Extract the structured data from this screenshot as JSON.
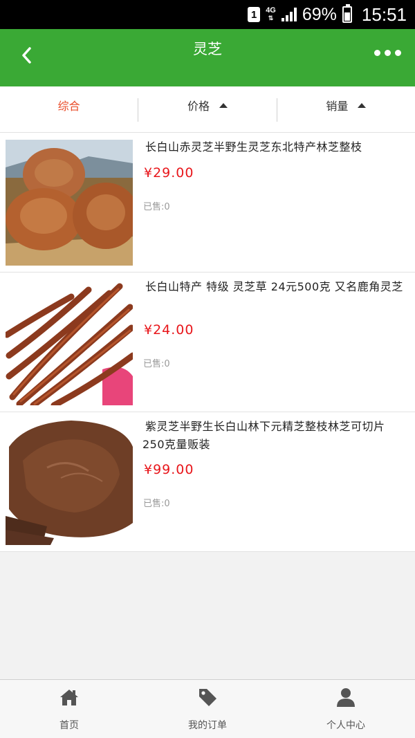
{
  "status_bar": {
    "sim": "1",
    "network": "4G",
    "battery_percent": "69%",
    "battery_level": 0.69,
    "time": "15:51"
  },
  "header": {
    "title": "灵芝",
    "back_icon": "chevron-left-icon",
    "more_icon": "more-dots-icon"
  },
  "sort_bar": {
    "items": [
      {
        "label": "综合",
        "active": true
      },
      {
        "label": "价格",
        "icon": "caret-up-icon"
      },
      {
        "label": "销量",
        "icon": "caret-up-icon"
      }
    ]
  },
  "products": [
    {
      "name": "长白山赤灵芝半野生灵芝东北特产林芝整枝",
      "price": "¥29.00",
      "sold": "已售:0"
    },
    {
      "name": "长白山特产 特级 灵芝草 24元500克 又名鹿角灵芝",
      "price": "¥24.00",
      "sold": "已售:0"
    },
    {
      "name": "紫灵芝半野生长白山林下元精芝整枝林芝可切片250克量贩装",
      "price": "¥99.00",
      "sold": "已售:0"
    }
  ],
  "tab_bar": {
    "items": [
      {
        "label": "首页",
        "icon": "home-icon"
      },
      {
        "label": "我的订单",
        "icon": "tag-icon"
      },
      {
        "label": "个人中心",
        "icon": "user-icon"
      }
    ]
  },
  "colors": {
    "brand_green": "#3aa935",
    "active_sort": "#e94c2a",
    "price_red": "#e8161b"
  }
}
